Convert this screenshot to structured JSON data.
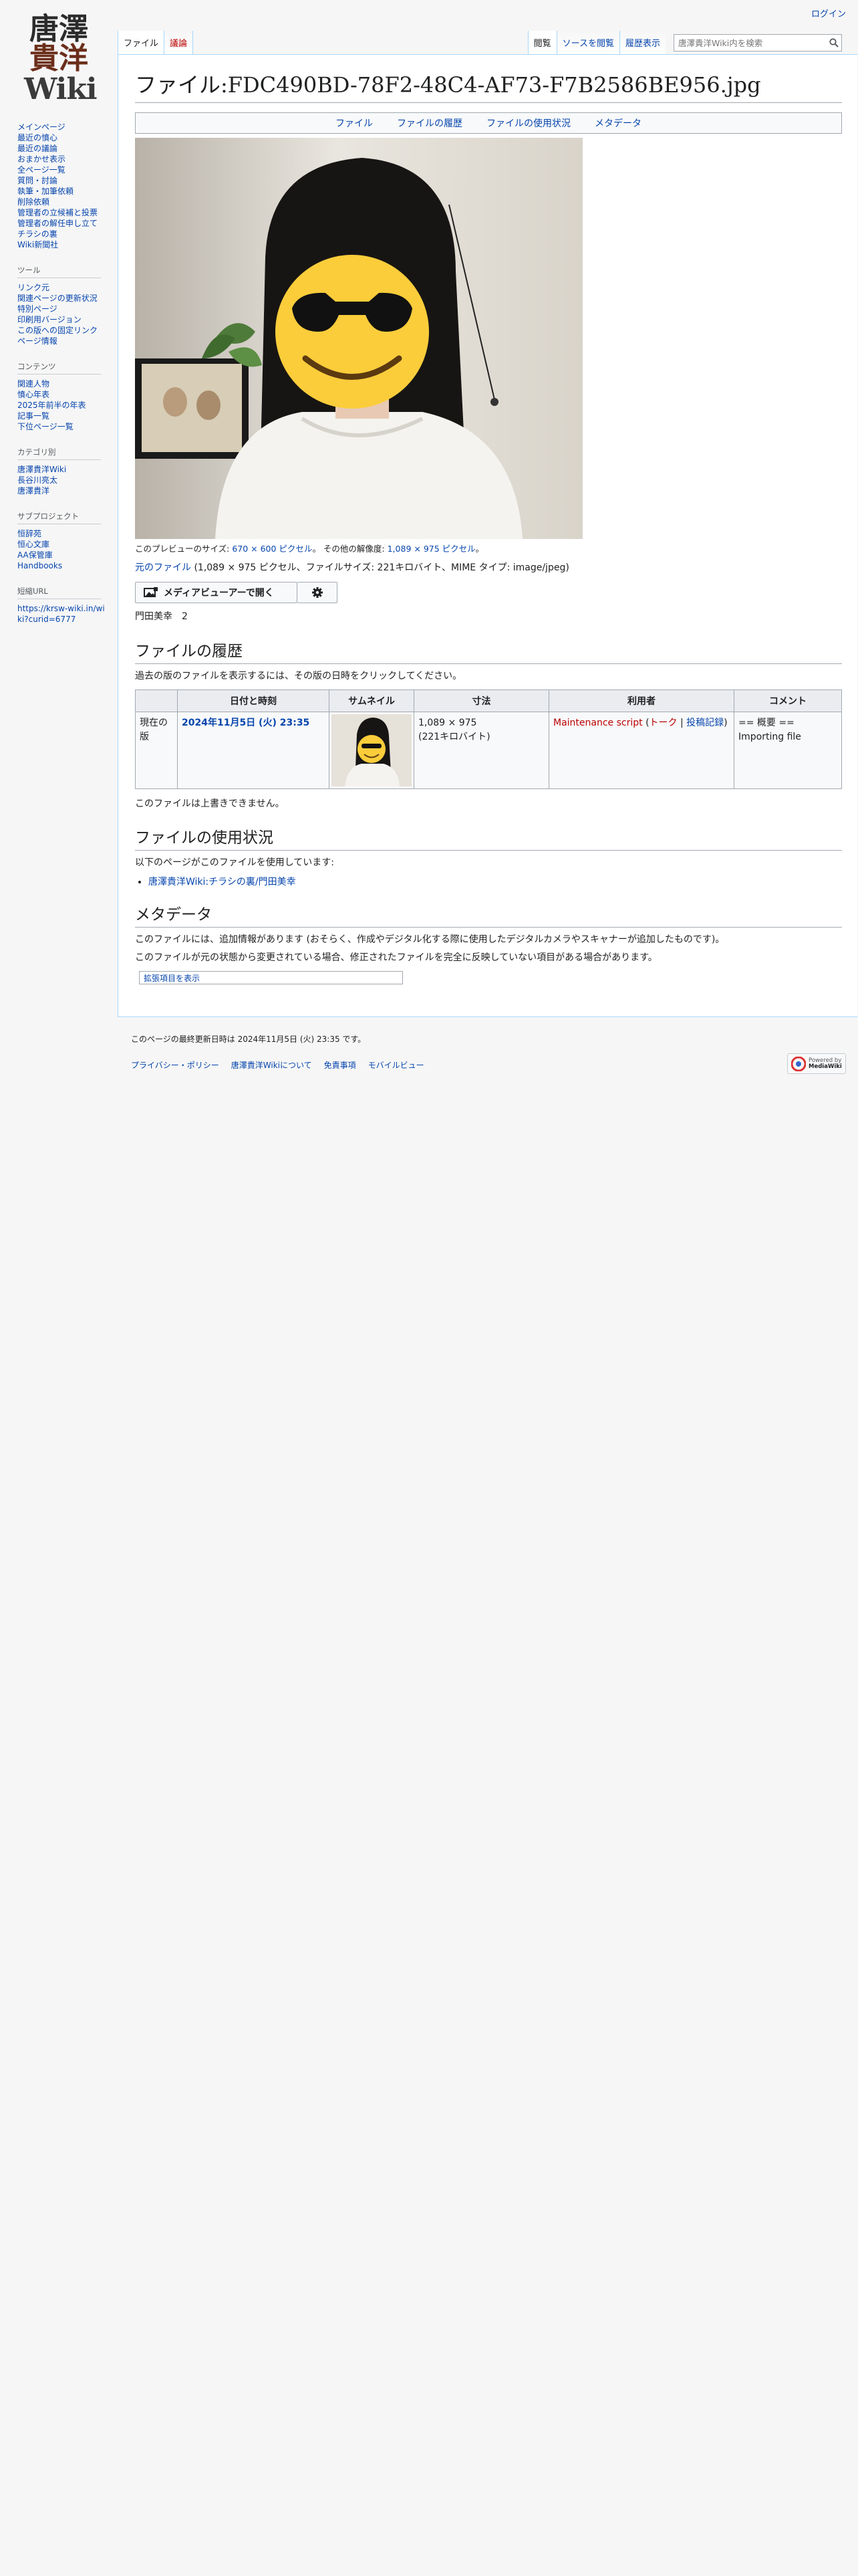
{
  "personal": {
    "login": "ログイン"
  },
  "logo": {
    "line1": "唐澤",
    "line2": "貴洋",
    "line3": "Wiki"
  },
  "sidebar": {
    "nav": [
      "メインページ",
      "最近の憤心",
      "最近の議論",
      "おまかせ表示",
      "全ページ一覧",
      "質問・討論",
      "執筆・加筆依頼",
      "削除依頼",
      "管理者の立候補と投票",
      "管理者の解任申し立て",
      "チラシの裏",
      "Wiki新聞社"
    ],
    "tools": {
      "heading": "ツール",
      "items": [
        "リンク元",
        "関連ページの更新状況",
        "特別ページ",
        "印刷用バージョン",
        "この版への固定リンク",
        "ページ情報"
      ]
    },
    "contents": {
      "heading": "コンテンツ",
      "items": [
        "関連人物",
        "憤心年表",
        "2025年前半の年表",
        "記事一覧",
        "下位ページ一覧"
      ]
    },
    "categories": {
      "heading": "カテゴリ別",
      "items": [
        "唐澤貴洋Wiki",
        "長谷川亮太",
        "唐澤貴洋"
      ]
    },
    "subprojects": {
      "heading": "サブプロジェクト",
      "items": [
        "恒辞苑",
        "恒心文庫",
        "AA保管庫",
        "Handbooks"
      ]
    },
    "shorturl": {
      "heading": "短縮URL",
      "url": "https://krsw-wiki.in/wiki?curid=6777"
    }
  },
  "tabs": {
    "left": [
      "ファイル",
      "議論"
    ],
    "right": [
      "閲覧",
      "ソースを閲覧",
      "履歴表示"
    ],
    "search_placeholder": "唐澤貴洋Wiki内を検索"
  },
  "page": {
    "title": "ファイル:FDC490BD-78F2-48C4-AF73-F7B2586BE956.jpg",
    "filetoc": [
      "ファイル",
      "ファイルの履歴",
      "ファイルの使用状況",
      "メタデータ"
    ],
    "preview_text_prefix": "このプレビューのサイズ: ",
    "preview_size": "670 × 600 ピクセル",
    "other_res_prefix": "。 その他の解像度: ",
    "other_res": "1,089 × 975 ピクセル",
    "other_res_suffix": "。",
    "original_link": "元のファイル",
    "original_info": " (1,089 × 975 ピクセル、ファイルサイズ: 221キロバイト、MIME タイプ: image/jpeg)",
    "mmv_button": "メディアビューアーで開く",
    "caption": "門田美幸　2",
    "history_heading": "ファイルの履歴",
    "history_intro": "過去の版のファイルを表示するには、その版の日時をクリックしてください。",
    "history_headers": [
      "",
      "日付と時刻",
      "サムネイル",
      "寸法",
      "利用者",
      "コメント"
    ],
    "history_row": {
      "status": "現在の版",
      "datetime": "2024年11月5日 (火) 23:35",
      "dims": "1,089 × 975",
      "size": "(221キロバイト)",
      "user": "Maintenance script",
      "talk": "トーク",
      "contribs": "投稿記録",
      "comment1": "== 概要 ==",
      "comment2": "Importing file"
    },
    "no_overwrite": "このファイルは上書きできません。",
    "usage_heading": "ファイルの使用状況",
    "usage_intro": "以下のページがこのファイルを使用しています:",
    "usage_link": "唐澤貴洋Wiki:チラシの裏/門田美幸",
    "metadata_heading": "メタデータ",
    "metadata_p1": "このファイルには、追加情報があります (おそらく、作成やデジタル化する際に使用したデジタルカメラやスキャナーが追加したものです)。",
    "metadata_p2": "このファイルが元の状態から変更されている場合、修正されたファイルを完全に反映していない項目がある場合があります。",
    "expand_label": "拡張項目を表示"
  },
  "footer": {
    "lastmod": "このページの最終更新日時は 2024年11月5日 (火) 23:35 です。",
    "links": [
      "プライバシー・ポリシー",
      "唐澤貴洋Wikiについて",
      "免責事項",
      "モバイルビュー"
    ],
    "powered_line1": "Powered by",
    "powered_line2": "MediaWiki"
  }
}
